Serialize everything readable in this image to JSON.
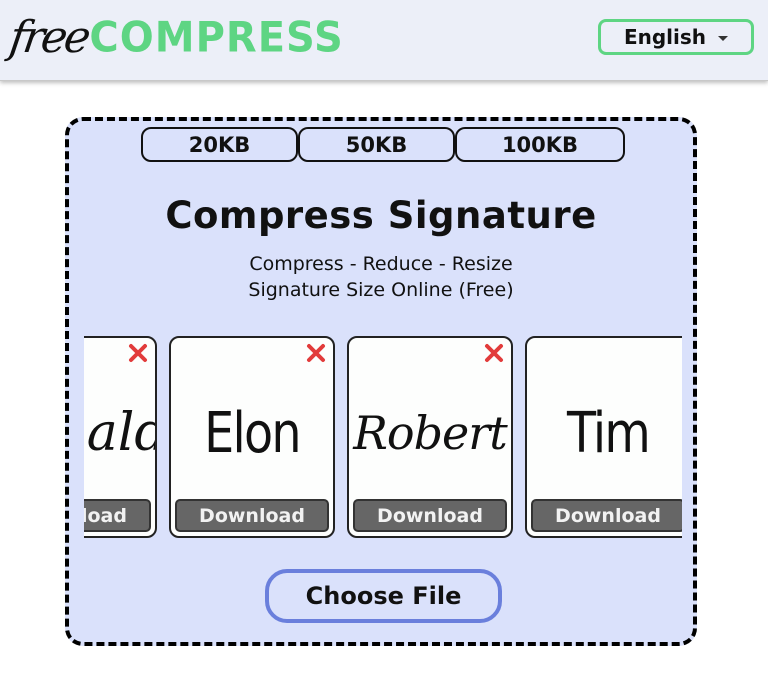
{
  "header": {
    "logo": {
      "part1": "free",
      "part2": "COMPRESS"
    },
    "language_select": {
      "selected": "English",
      "icon": "caret-down-icon"
    }
  },
  "main": {
    "size_tabs": [
      {
        "label": "20KB"
      },
      {
        "label": "50KB"
      },
      {
        "label": "100KB"
      }
    ],
    "title": "Compress Signature",
    "subtitle_line1": "Compress - Reduce - Resize",
    "subtitle_line2": "Signature Size Online (Free)",
    "samples": [
      {
        "signature": "Donald",
        "download_label": "Download",
        "has_remove": true
      },
      {
        "signature": "Elon",
        "download_label": "Download",
        "has_remove": true
      },
      {
        "signature": "Robert",
        "download_label": "Download",
        "has_remove": true
      },
      {
        "signature": "Tim",
        "download_label": "Download",
        "has_remove": false
      }
    ],
    "choose_file_label": "Choose File"
  },
  "colors": {
    "brand_green": "#5ed583",
    "panel_bg": "#dae1fb",
    "header_bg": "#eceff8",
    "remove_red": "#e23b3b",
    "download_bg": "#666666",
    "choose_border": "#6a7fdc"
  }
}
